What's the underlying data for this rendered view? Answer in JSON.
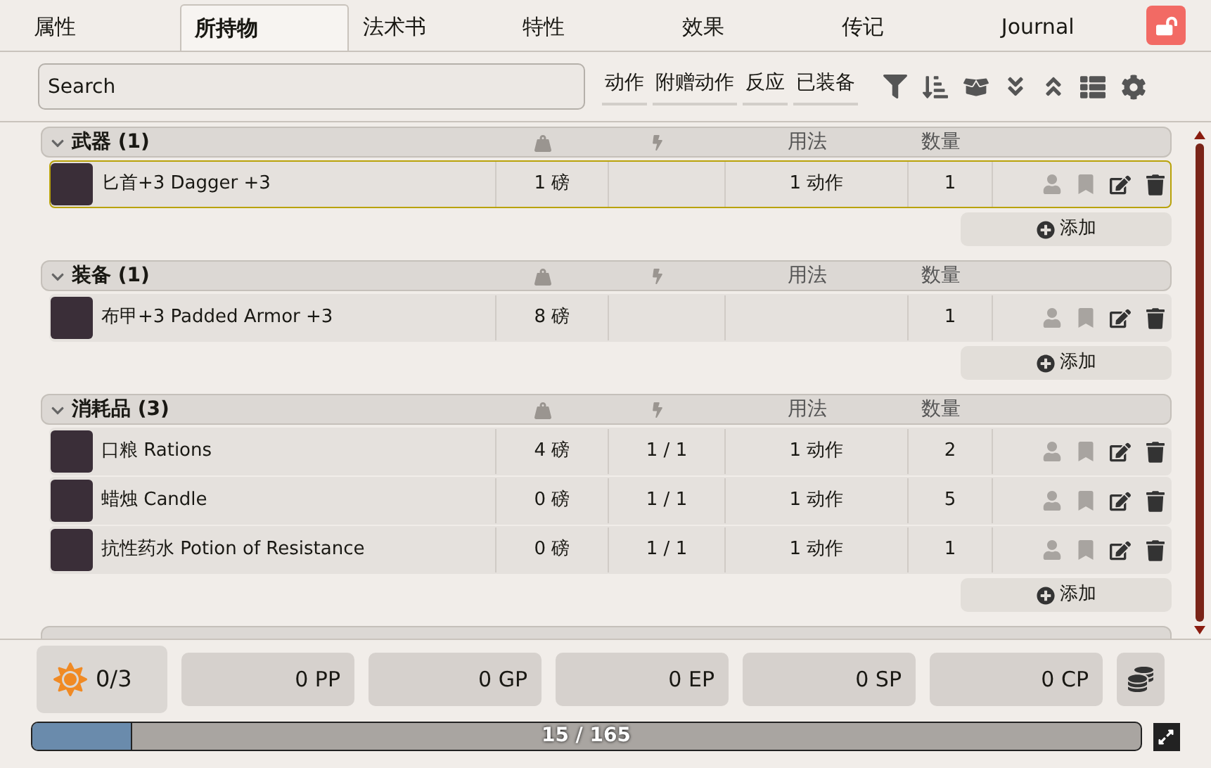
{
  "tabs": [
    {
      "label": "属性",
      "selected": false
    },
    {
      "label": "所持物",
      "selected": true
    },
    {
      "label": "法术书",
      "selected": false
    },
    {
      "label": "特性",
      "selected": false
    },
    {
      "label": "效果",
      "selected": false
    },
    {
      "label": "传记",
      "selected": false
    },
    {
      "label": "Journal",
      "selected": false
    }
  ],
  "search": {
    "placeholder": "Search"
  },
  "filters": [
    {
      "label": "动作"
    },
    {
      "label": "附赠动作"
    },
    {
      "label": "反应"
    },
    {
      "label": "已装备"
    }
  ],
  "sections": [
    {
      "title": "武器 (1)",
      "usage_header": "用法",
      "quantity_header": "数量",
      "add_label": "添加",
      "items": [
        {
          "name": "匕首+3 Dagger +3",
          "weight": "1 磅",
          "usage": "1 动作",
          "quantity": "1",
          "selected": true
        }
      ]
    },
    {
      "title": "装备 (1)",
      "usage_header": "用法",
      "quantity_header": "数量",
      "add_label": "添加",
      "items": [
        {
          "name": "布甲+3 Padded Armor +3",
          "weight": "8 磅",
          "quantity": "1",
          "selected": false
        }
      ]
    },
    {
      "title": "消耗品 (3)",
      "usage_header": "用法",
      "quantity_header": "数量",
      "add_label": "添加",
      "items": [
        {
          "name": "口粮 Rations",
          "weight": "4 磅",
          "charges": "1 / 1",
          "usage": "1 动作",
          "quantity": "2",
          "selected": false
        },
        {
          "name": "蜡烛 Candle",
          "weight": "0 磅",
          "charges": "1 / 1",
          "usage": "1 动作",
          "quantity": "5",
          "selected": false
        },
        {
          "name": "抗性药水 Potion of Resistance",
          "weight": "0 磅",
          "charges": "1 / 1",
          "usage": "1 动作",
          "quantity": "1",
          "selected": false
        }
      ]
    }
  ],
  "footer": {
    "inspiration": "0/3",
    "currencies": [
      {
        "label": "0 PP"
      },
      {
        "label": "0 GP"
      },
      {
        "label": "0 EP"
      },
      {
        "label": "0 SP"
      },
      {
        "label": "0 CP"
      }
    ],
    "encumbrance": {
      "label": "15 / 165",
      "level": 0.09
    }
  }
}
